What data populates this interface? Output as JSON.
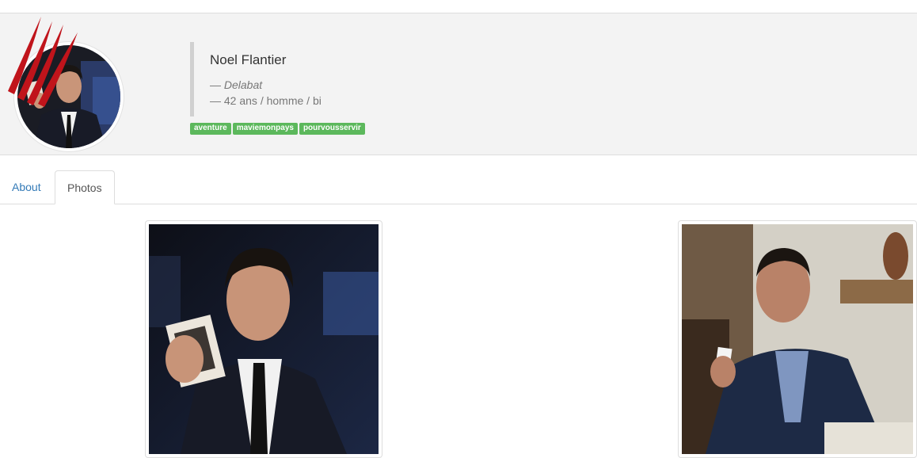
{
  "profile": {
    "name": "Noel Flantier",
    "location": "Delabat",
    "details": "42 ans / homme / bi",
    "tags": [
      "aventure",
      "maviemonpays",
      "pourvousservir"
    ]
  },
  "tabs": {
    "about": "About",
    "photos": "Photos"
  },
  "photos": [
    {
      "subject": "man-holding-photograph"
    },
    {
      "subject": "man-holding-card-seated"
    }
  ],
  "colors": {
    "tag_green": "#5cb85c",
    "link_blue": "#337ab7",
    "claw_red": "#c0141b"
  }
}
